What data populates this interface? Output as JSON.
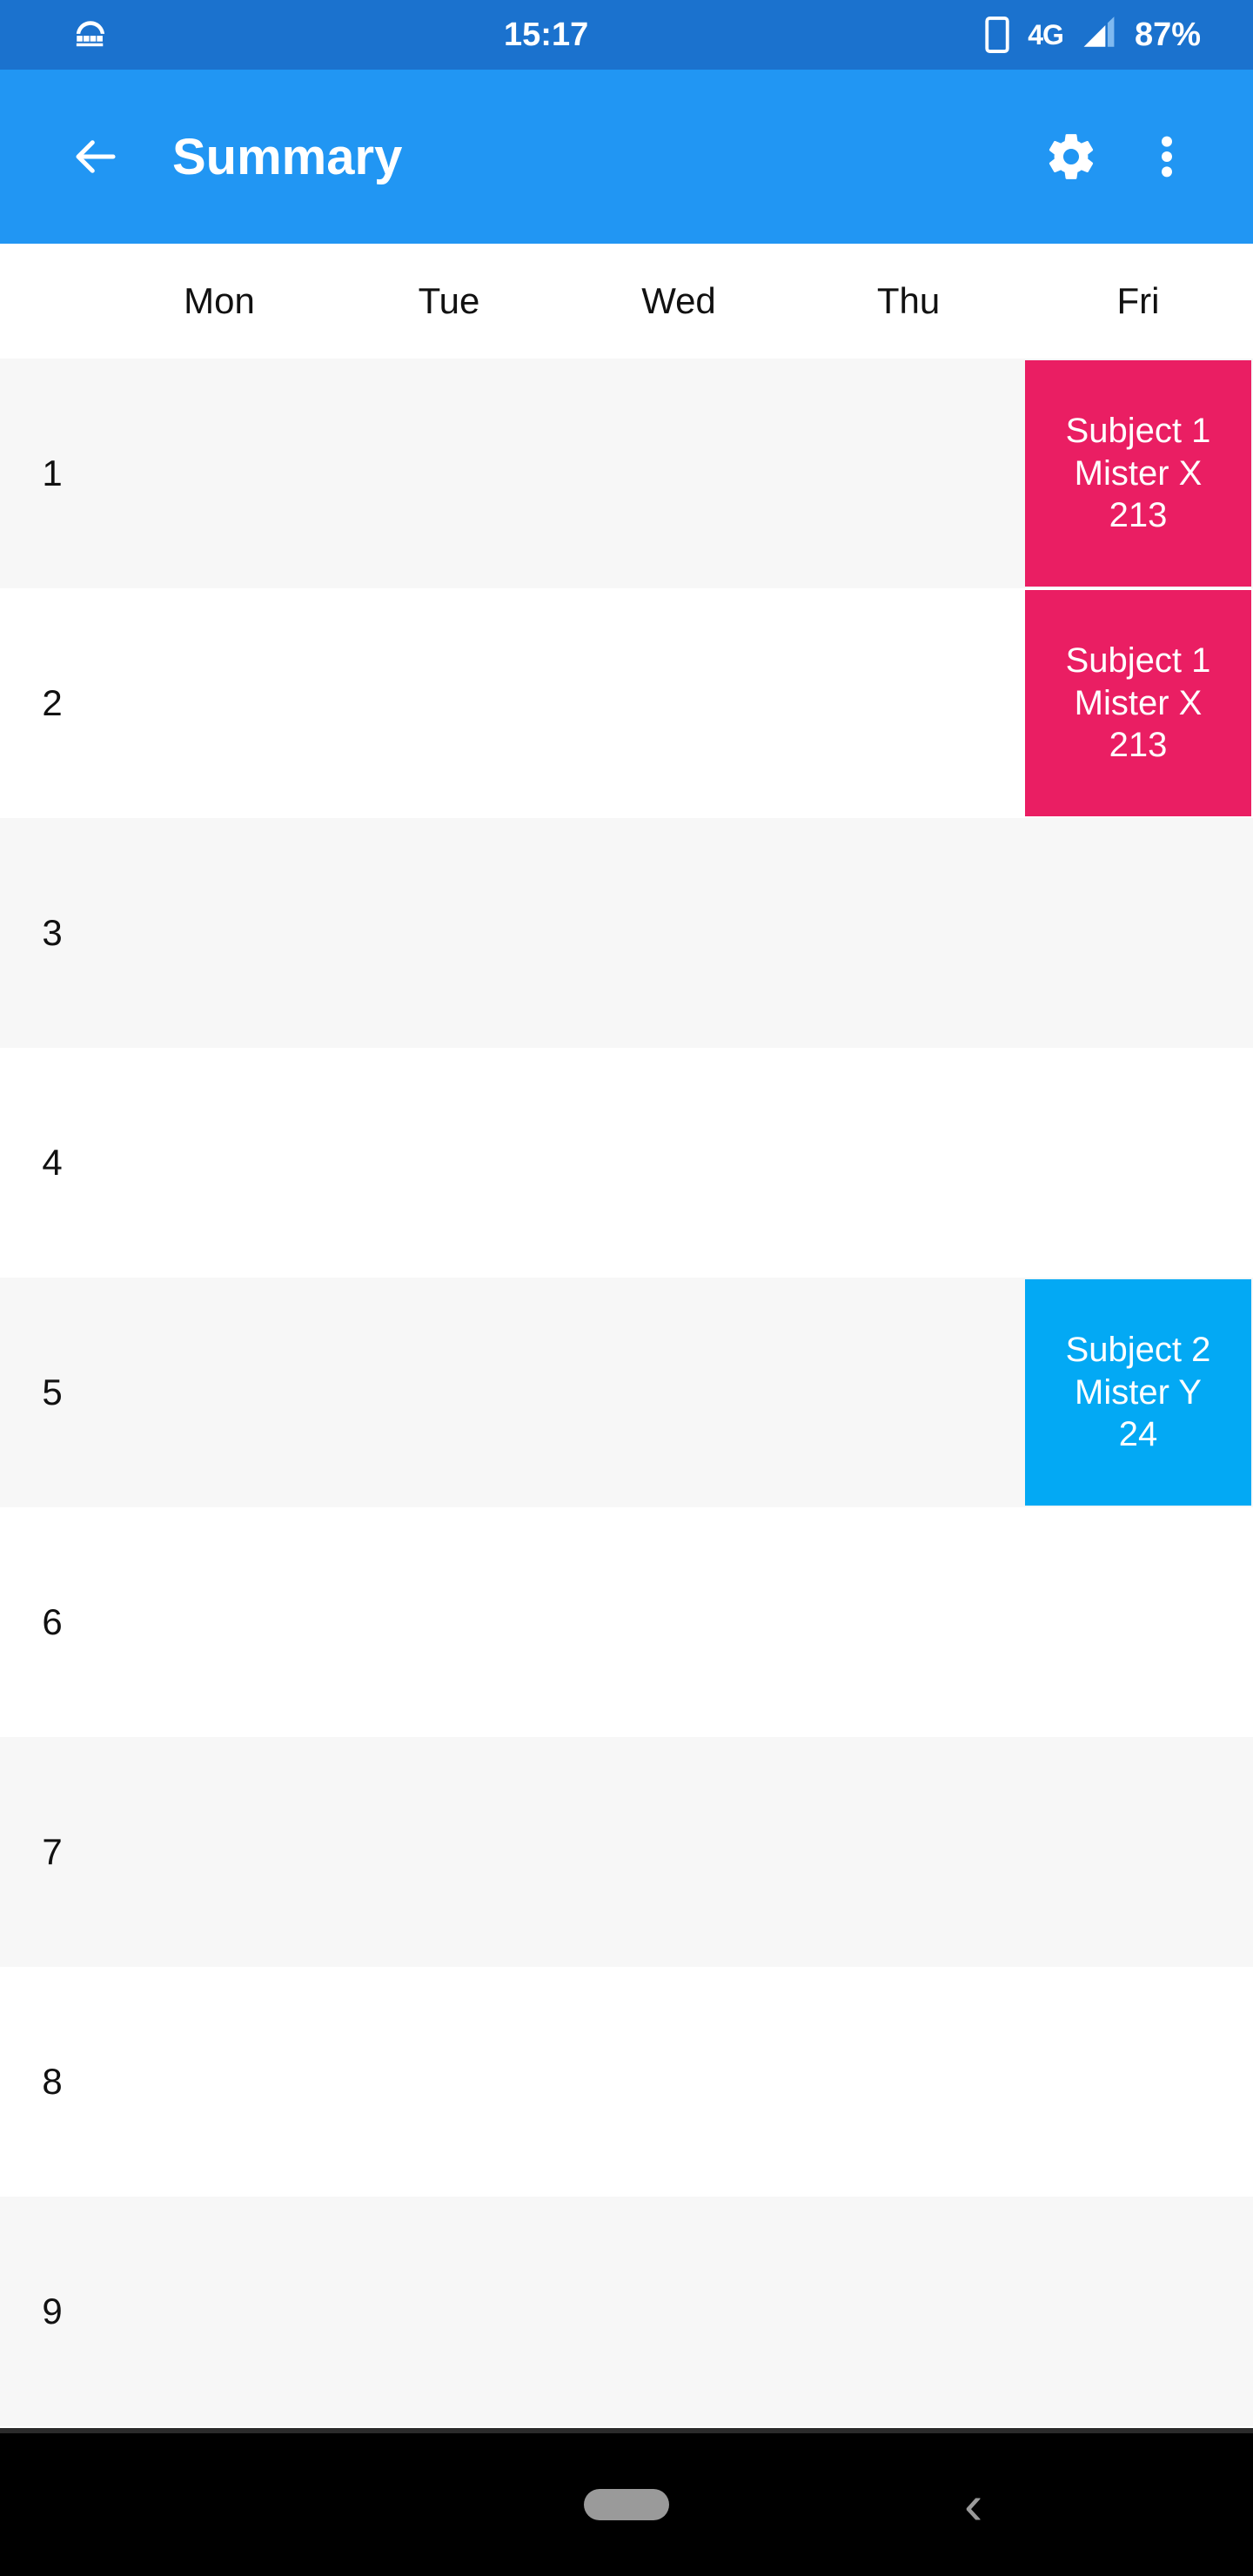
{
  "status_bar": {
    "notification_icon": "dome-basket-icon",
    "time": "15:17",
    "sim_icon": "phone-sim-icon",
    "network": "4G",
    "signal_icon": "signal-bars-icon",
    "battery": "87%",
    "background_color": "#1B72CE"
  },
  "app_bar": {
    "back_icon": "back-arrow-icon",
    "title": "Summary",
    "settings_icon": "gear-icon",
    "overflow_icon": "more-vertical-icon",
    "background_color": "#2196F3"
  },
  "timetable": {
    "day_headers": [
      "Mon",
      "Tue",
      "Wed",
      "Thu",
      "Fri"
    ],
    "period_numbers": [
      "1",
      "2",
      "3",
      "4",
      "5",
      "6",
      "7",
      "8",
      "9"
    ],
    "row_colors": {
      "odd": "#f7f7f7",
      "even": "#ffffff"
    },
    "events": [
      {
        "period": "1",
        "day": "Fri",
        "subject": "Subject 1",
        "teacher": "Mister X",
        "room": "213",
        "color": "#EA1E63"
      },
      {
        "period": "2",
        "day": "Fri",
        "subject": "Subject 1",
        "teacher": "Mister X",
        "room": "213",
        "color": "#EA1E63"
      },
      {
        "period": "5",
        "day": "Fri",
        "subject": "Subject 2",
        "teacher": "Mister Y",
        "room": "24",
        "color": "#03A9F4"
      }
    ]
  },
  "nav_bar": {
    "home_pill": "home-pill-icon",
    "back_chevron": "‹",
    "background_color": "#000000"
  }
}
